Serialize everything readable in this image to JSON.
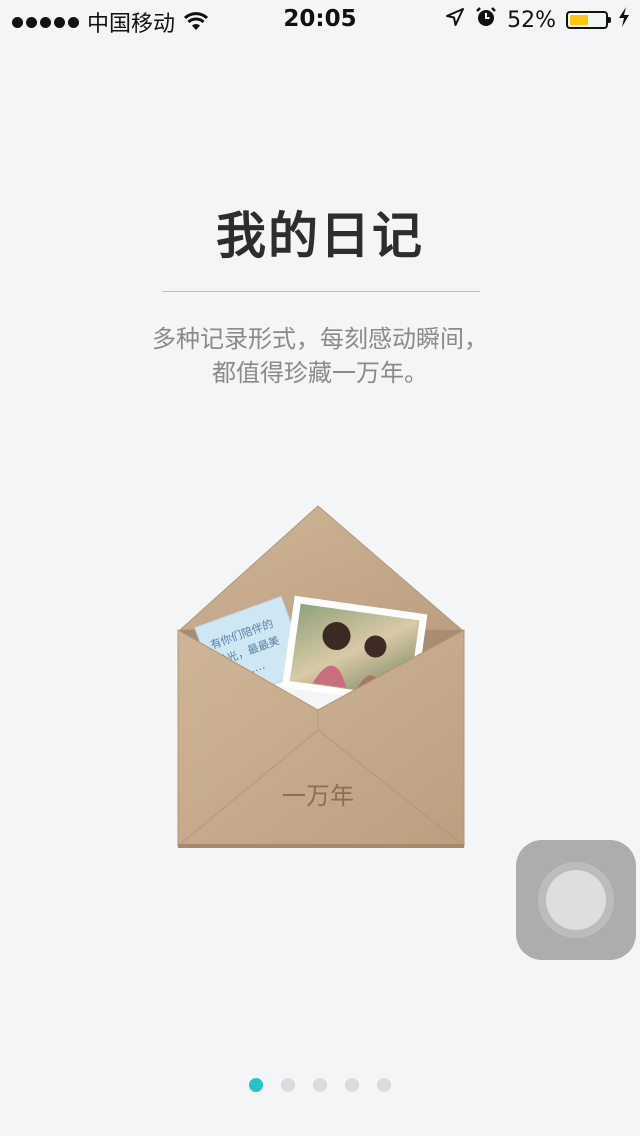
{
  "status": {
    "carrier": "中国移动",
    "time": "20:05",
    "battery_percent": "52%",
    "battery_level": 0.52,
    "icons": [
      "signal-dots-icon",
      "wifi-icon",
      "location-arrow-icon",
      "alarm-icon",
      "battery-icon",
      "charging-icon"
    ]
  },
  "intro": {
    "title": "我的日记",
    "subtitle_line1": "多种记录形式，每刻感动瞬间，",
    "subtitle_line2": "都值得珍藏一万年。"
  },
  "illustration": {
    "note_line1": "有你们陪伴的",
    "note_line2": "时光，最最美",
    "note_line3": "好光……",
    "envelope_text": "一万年"
  },
  "pager": {
    "page_count": 5,
    "active_index": 0
  },
  "colors": {
    "accent": "#27c3c6",
    "background": "#f4f5f7",
    "battery": "#ffc800",
    "envelope": "#c7ab8c"
  }
}
